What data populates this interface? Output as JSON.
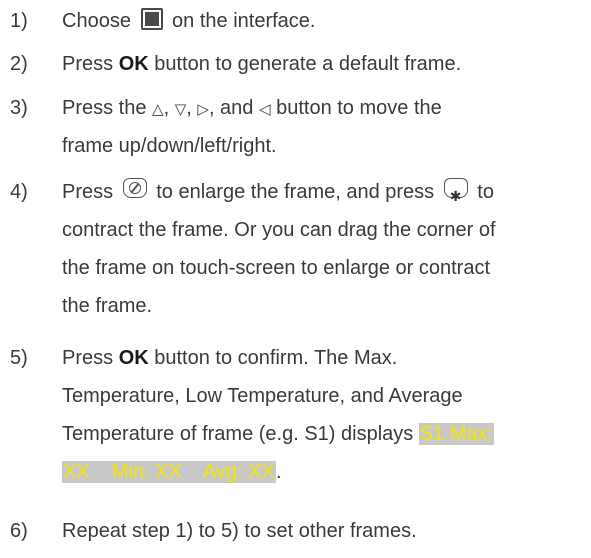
{
  "steps": [
    {
      "num": "1)",
      "lines": [
        {
          "a": "Choose ",
          "icon": "frame-tool-icon",
          "b": " on the interface."
        }
      ]
    },
    {
      "num": "2)",
      "lines": [
        {
          "a": "Press ",
          "bold": "OK",
          "b": " button to generate a default frame."
        }
      ]
    },
    {
      "num": "3)",
      "lines": [
        {
          "a": "Press the ",
          "up": "△",
          "c1": ", ",
          "down": "▽",
          "c2": ", ",
          "right": "▷",
          "c3": ", and ",
          "left": "◁",
          "b": " button to move the"
        },
        {
          "text": "frame up/down/left/right."
        }
      ]
    },
    {
      "num": "4)",
      "lines": [
        {
          "a": "Press ",
          "icon1": "enlarge-key-icon",
          "m": " to enlarge the frame, and press ",
          "icon2": "contract-key-icon",
          "b": " to"
        },
        {
          "text": "contract the frame. Or you can drag the corner of"
        },
        {
          "text": "the frame on touch-screen to enlarge or contract"
        },
        {
          "text": "the frame."
        }
      ]
    },
    {
      "num": "5)",
      "lines": [
        {
          "a": "Press ",
          "bold": "OK",
          "b": " button to confirm. The Max."
        },
        {
          "text": "Temperature, Low Temperature, and Average"
        },
        {
          "a": "Temperature of frame (e.g. S1) displays ",
          "hl": "S1 Max:"
        },
        {
          "hl": "XX    Min: XX    Avg: XX",
          "b": "."
        }
      ]
    },
    {
      "num": "6)",
      "lines": [
        {
          "text": "Repeat step 1) to 5) to set other frames."
        }
      ]
    }
  ],
  "colors": {
    "text": "#3a3a3a",
    "highlight_bg": "#c8c8c8",
    "highlight_fg": "#f5e600"
  }
}
